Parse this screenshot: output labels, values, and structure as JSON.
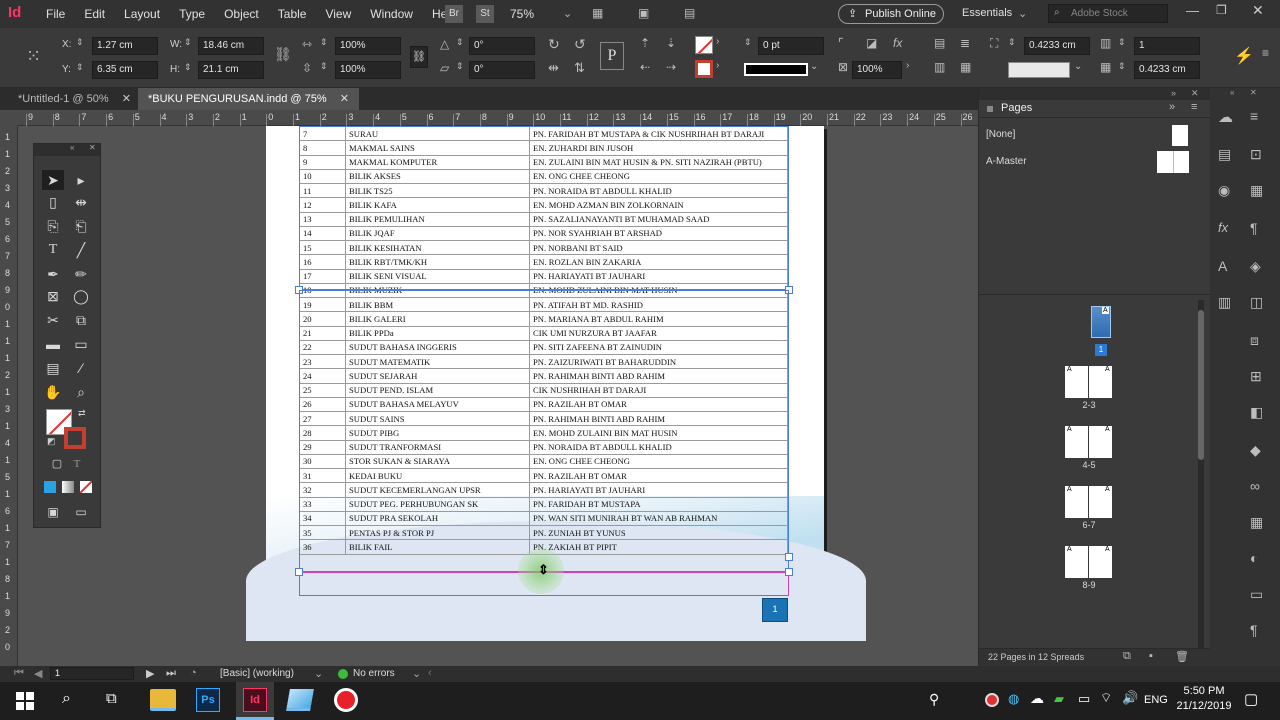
{
  "menubar": {
    "logo": "Id",
    "items": [
      "File",
      "Edit",
      "Layout",
      "Type",
      "Object",
      "Table",
      "View",
      "Window",
      "Help"
    ],
    "bridge": "Br",
    "stock": "St",
    "zoom": "75%",
    "publish_online": "Publish Online",
    "workspace": "Essentials",
    "search_placeholder": "Adobe Stock"
  },
  "control": {
    "x_label": "X:",
    "x_value": "1.27 cm",
    "y_label": "Y:",
    "y_value": "6.35 cm",
    "w_label": "W:",
    "w_value": "18.46 cm",
    "h_label": "H:",
    "h_value": "21.1 cm",
    "scale_x": "100%",
    "scale_y": "100%",
    "rotate": "0°",
    "shear": "0°",
    "stroke_weight": "0 pt",
    "opacity": "100%",
    "fitting_1": "0.4233 cm",
    "fitting_2": "0.4233 cm",
    "columns": "1"
  },
  "tabs": [
    {
      "label": "*Untitled-1 @ 50%"
    },
    {
      "label": "*BUKU PENGURUSAN.indd @ 75%"
    }
  ],
  "ruler_h": [
    "9",
    "8",
    "7",
    "6",
    "5",
    "4",
    "3",
    "2",
    "1",
    "0",
    "1",
    "2",
    "3",
    "4",
    "5",
    "6",
    "7",
    "8",
    "9",
    "10",
    "11",
    "12",
    "13",
    "14",
    "15",
    "16",
    "17",
    "18",
    "19",
    "20",
    "21",
    "22",
    "23",
    "24",
    "25",
    "26"
  ],
  "ruler_v": [
    "1",
    "1",
    "2",
    "3",
    "4",
    "5",
    "6",
    "7",
    "8",
    "9",
    "0",
    "1",
    "1",
    "1",
    "2",
    "1",
    "3",
    "1",
    "4",
    "1",
    "5",
    "1",
    "6",
    "1",
    "7",
    "1",
    "8",
    "1",
    "9",
    "2",
    "0"
  ],
  "table_rows": [
    [
      "7",
      "SURAU",
      "PN. FARIDAH BT MUSTAPA & CIK NUSHRIHAH BT DARAJI"
    ],
    [
      "8",
      "MAKMAL SAINS",
      "EN. ZUHARDI BIN JUSOH"
    ],
    [
      "9",
      "MAKMAL KOMPUTER",
      "EN. ZULAINI BIN MAT HUSIN & PN. SITI NAZIRAH (PBTU)"
    ],
    [
      "10",
      "BILIK AKSES",
      "EN. ONG CHEE CHEONG"
    ],
    [
      "11",
      "BILIK TS25",
      "PN. NORAIDA BT ABDULL KHALID"
    ],
    [
      "12",
      "BILIK KAFA",
      "EN. MOHD AZMAN BIN ZOLKORNAIN"
    ],
    [
      "13",
      "BILIK PEMULIHAN",
      "PN. SAZALIANAYANTI BT MUHAMAD SAAD"
    ],
    [
      "14",
      "BILIK JQAF",
      "PN. NOR SYAHRIAH BT ARSHAD"
    ],
    [
      "15",
      "BILIK KESIHATAN",
      "PN. NORBANI BT SAID"
    ],
    [
      "16",
      "BILIK RBT/TMK/KH",
      "EN. ROZLAN BIN ZAKARIA"
    ],
    [
      "17",
      "BILIK SENI VISUAL",
      "PN. HARIAYATI BT JAUHARI"
    ],
    [
      "18",
      "BILIK MUZIK",
      "EN. MOHD ZULAINI BIN MAT HUSIN"
    ],
    [
      "19",
      "BILIK BBM",
      "PN. ATIFAH BT MD. RASHID"
    ],
    [
      "20",
      "BILIK GALERI",
      "PN. MARIANA BT ABDUL RAHIM"
    ],
    [
      "21",
      "BILIK PPDa",
      "CIK UMI NURZURA BT JAAFAR"
    ],
    [
      "22",
      "SUDUT BAHASA INGGERIS",
      "PN. SITI ZAFEENA BT ZAINUDIN"
    ],
    [
      "23",
      "SUDUT MATEMATIK",
      "PN. ZAIZURIWATI BT BAHARUDDIN"
    ],
    [
      "24",
      "SUDUT SEJARAH",
      "PN. RAHIMAH BINTI ABD RAHIM"
    ],
    [
      "25",
      "SUDUT PEND. ISLAM",
      "CIK NUSHRIHAH BT DARAJI"
    ],
    [
      "26",
      "SUDUT BAHASA MELAYUV",
      "PN. RAZILAH BT OMAR"
    ],
    [
      "27",
      "SUDUT SAINS",
      "PN. RAHIMAH BINTI ABD RAHIM"
    ],
    [
      "28",
      "SUDUT PIBG",
      "EN. MOHD ZULAINI BIN MAT HUSIN"
    ],
    [
      "29",
      "SUDUT TRANFORMASI",
      "PN. NORAIDA BT ABDULL KHALID"
    ],
    [
      "30",
      "STOR SUKAN & SIARAYA",
      "EN. ONG CHEE CHEONG"
    ],
    [
      "31",
      "KEDAI BUKU",
      "PN. RAZILAH BT OMAR"
    ],
    [
      "32",
      "SUDUT KECEMERLANGAN UPSR",
      "PN. HARIAYATI BT JAUHARI"
    ],
    [
      "33",
      "SUDUT PEG. PERHUBUNGAN SK",
      "PN. FARIDAH BT MUSTAPA"
    ],
    [
      "34",
      "SUDUT PRA SEKOLAH",
      "PN. WAN SITI MUNIRAH BT WAN AB RAHMAN"
    ],
    [
      "35",
      "PENTAS PJ & STOR PJ",
      "PN. ZUNIAH BT YUNUS"
    ],
    [
      "36",
      "BILIK FAIL",
      "PN. ZAKIAH BT PIPIT"
    ]
  ],
  "page_number_marker": "1",
  "pages_panel": {
    "title": "Pages",
    "none": "[None]",
    "master": "A-Master",
    "page_labels": [
      "1",
      "2-3",
      "4-5",
      "6-7",
      "8-9"
    ],
    "master_letter": "A",
    "footer": "22 Pages in 12 Spreads"
  },
  "status": {
    "page": "1",
    "style": "[Basic] (working)",
    "errors": "No errors"
  },
  "taskbar": {
    "lang": "ENG",
    "time": "5:50 PM",
    "date": "21/12/2019"
  },
  "colors": {
    "accent": "#1a73b4",
    "magenta": "#ff3366"
  }
}
